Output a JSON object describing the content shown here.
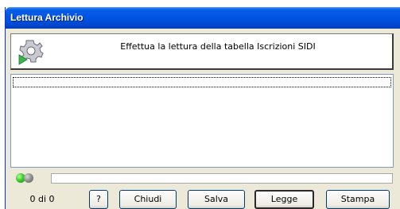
{
  "window": {
    "title": "Lettura Archivio"
  },
  "header": {
    "icon": "gear-icon",
    "text": "Effettua la lettura della tabella Iscrizioni SIDI"
  },
  "status": {
    "indicators": [
      "green-led",
      "gray-led"
    ],
    "progress": 0,
    "counter": "0 di 0"
  },
  "buttons": {
    "help": "?",
    "close": "Chiudi",
    "save": "Salva",
    "read": "Legge",
    "print": "Stampa"
  },
  "colors": {
    "titlebar": "#0054e3",
    "window_bg": "#ece9d8",
    "led_on": "#3dcb2d",
    "led_off": "#8d8d8d"
  }
}
